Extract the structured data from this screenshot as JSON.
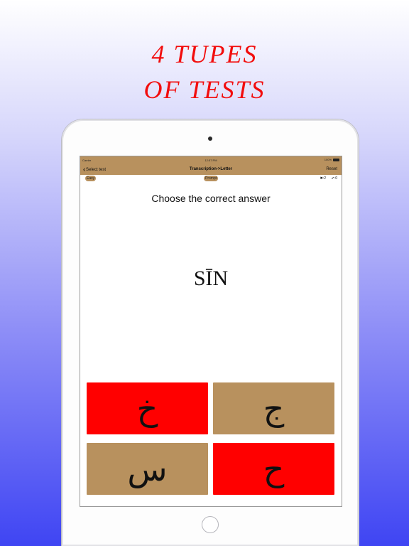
{
  "promo": {
    "line1": "4 TUPES",
    "line2": "OF TESTS"
  },
  "status": {
    "carrier": "Carrier",
    "time": "12:57 PM",
    "battery": "100%"
  },
  "nav": {
    "back_label": "Select test",
    "title": "Transcription->Letter",
    "reset_label": "Reset"
  },
  "controls": {
    "easy_label": "Easy",
    "prompt_label": "Prompt",
    "wrong_count": "✖:2",
    "right_count": "✔:0"
  },
  "question": {
    "instruction": "Choose the correct answer",
    "word": "SĪN"
  },
  "answers": [
    {
      "letter": "خ",
      "state": "wrong"
    },
    {
      "letter": "ج",
      "state": "neutral"
    },
    {
      "letter": "س",
      "state": "neutral"
    },
    {
      "letter": "ح",
      "state": "wrong"
    }
  ],
  "colors": {
    "accent": "#b8915e",
    "wrong": "#ff0000",
    "headline": "#f20d0d",
    "bg_bottom": "#3f45f3"
  }
}
